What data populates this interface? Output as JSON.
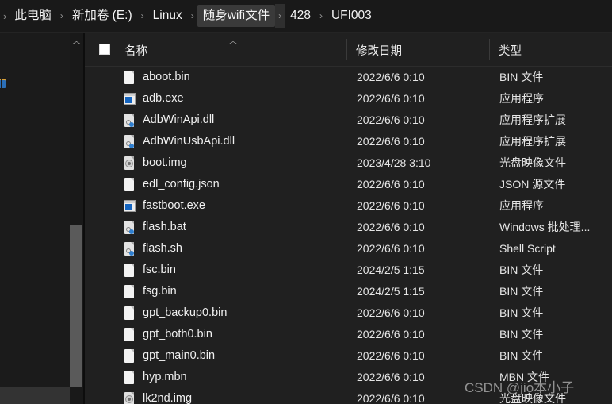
{
  "window": {
    "title": "UFI003"
  },
  "breadcrumb": {
    "separator": "›",
    "lead_separator": "›",
    "items": [
      {
        "label": "此电脑",
        "highlighted": false
      },
      {
        "label": "新加卷 (E:)",
        "highlighted": false
      },
      {
        "label": "Linux",
        "highlighted": false
      },
      {
        "label": "随身wifi文件",
        "highlighted": true
      },
      {
        "label": "428",
        "highlighted": false
      },
      {
        "label": "UFI003",
        "highlighted": false
      }
    ]
  },
  "columns": {
    "name": "名称",
    "date_modified": "修改日期",
    "type": "类型",
    "sort_caret": "︿",
    "sort_column": "名称",
    "sort_direction": "ascending"
  },
  "files": [
    {
      "name": "aboot.bin",
      "date": "2022/6/6 0:10",
      "type": "BIN 文件",
      "icon": "file-doc-icon"
    },
    {
      "name": "adb.exe",
      "date": "2022/6/6 0:10",
      "type": "应用程序",
      "icon": "file-application-icon"
    },
    {
      "name": "AdbWinApi.dll",
      "date": "2022/6/6 0:10",
      "type": "应用程序扩展",
      "icon": "file-library-icon"
    },
    {
      "name": "AdbWinUsbApi.dll",
      "date": "2022/6/6 0:10",
      "type": "应用程序扩展",
      "icon": "file-library-icon"
    },
    {
      "name": "boot.img",
      "date": "2023/4/28 3:10",
      "type": "光盘映像文件",
      "icon": "file-disc-image-icon"
    },
    {
      "name": "edl_config.json",
      "date": "2022/6/6 0:10",
      "type": "JSON 源文件",
      "icon": "file-doc-icon"
    },
    {
      "name": "fastboot.exe",
      "date": "2022/6/6 0:10",
      "type": "应用程序",
      "icon": "file-application-icon"
    },
    {
      "name": "flash.bat",
      "date": "2022/6/6 0:10",
      "type": "Windows 批处理...",
      "icon": "file-script-icon"
    },
    {
      "name": "flash.sh",
      "date": "2022/6/6 0:10",
      "type": "Shell Script",
      "icon": "file-script-icon"
    },
    {
      "name": "fsc.bin",
      "date": "2024/2/5 1:15",
      "type": "BIN 文件",
      "icon": "file-doc-icon"
    },
    {
      "name": "fsg.bin",
      "date": "2024/2/5 1:15",
      "type": "BIN 文件",
      "icon": "file-doc-icon"
    },
    {
      "name": "gpt_backup0.bin",
      "date": "2022/6/6 0:10",
      "type": "BIN 文件",
      "icon": "file-doc-icon"
    },
    {
      "name": "gpt_both0.bin",
      "date": "2022/6/6 0:10",
      "type": "BIN 文件",
      "icon": "file-doc-icon"
    },
    {
      "name": "gpt_main0.bin",
      "date": "2022/6/6 0:10",
      "type": "BIN 文件",
      "icon": "file-doc-icon"
    },
    {
      "name": "hyp.mbn",
      "date": "2022/6/6 0:10",
      "type": "MBN 文件",
      "icon": "file-doc-icon"
    },
    {
      "name": "lk2nd.img",
      "date": "2022/6/6 0:10",
      "type": "光盘映像文件",
      "icon": "file-disc-image-icon"
    }
  ],
  "scrollbar": {
    "up_arrow": "︿"
  },
  "watermark": {
    "text": "CSDN @jio本小子"
  },
  "colors": {
    "background": "#1b1b1b",
    "list_background": "#202020",
    "addressbar_background": "#191919",
    "text": "#f0f0f0",
    "breadcrumb_highlight": "#3a3a3a",
    "scroll_thumb": "#5a5a5a",
    "accent_blue": "#1565c0",
    "folder_yellow": "#d8a13a"
  }
}
